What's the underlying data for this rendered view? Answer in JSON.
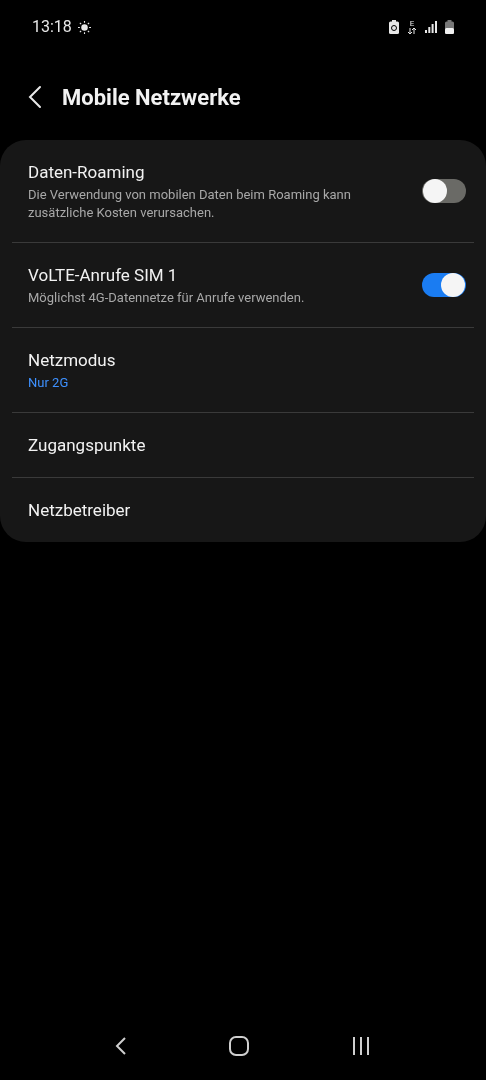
{
  "status_bar": {
    "time": "13:18",
    "network_type": "E"
  },
  "header": {
    "title": "Mobile Netzwerke"
  },
  "settings": [
    {
      "kind": "toggle",
      "title": "Daten-Roaming",
      "subtitle": "Die Verwendung von mobilen Daten beim Roaming kann zusätzliche Kosten verursachen.",
      "on": false
    },
    {
      "kind": "toggle",
      "title": "VoLTE-Anrufe SIM 1",
      "subtitle": "Möglichst 4G-Datennetze für Anrufe verwenden.",
      "on": true
    },
    {
      "kind": "value",
      "title": "Netzmodus",
      "value": "Nur 2G"
    },
    {
      "kind": "plain",
      "title": "Zugangspunkte"
    },
    {
      "kind": "plain",
      "title": "Netzbetreiber"
    }
  ]
}
